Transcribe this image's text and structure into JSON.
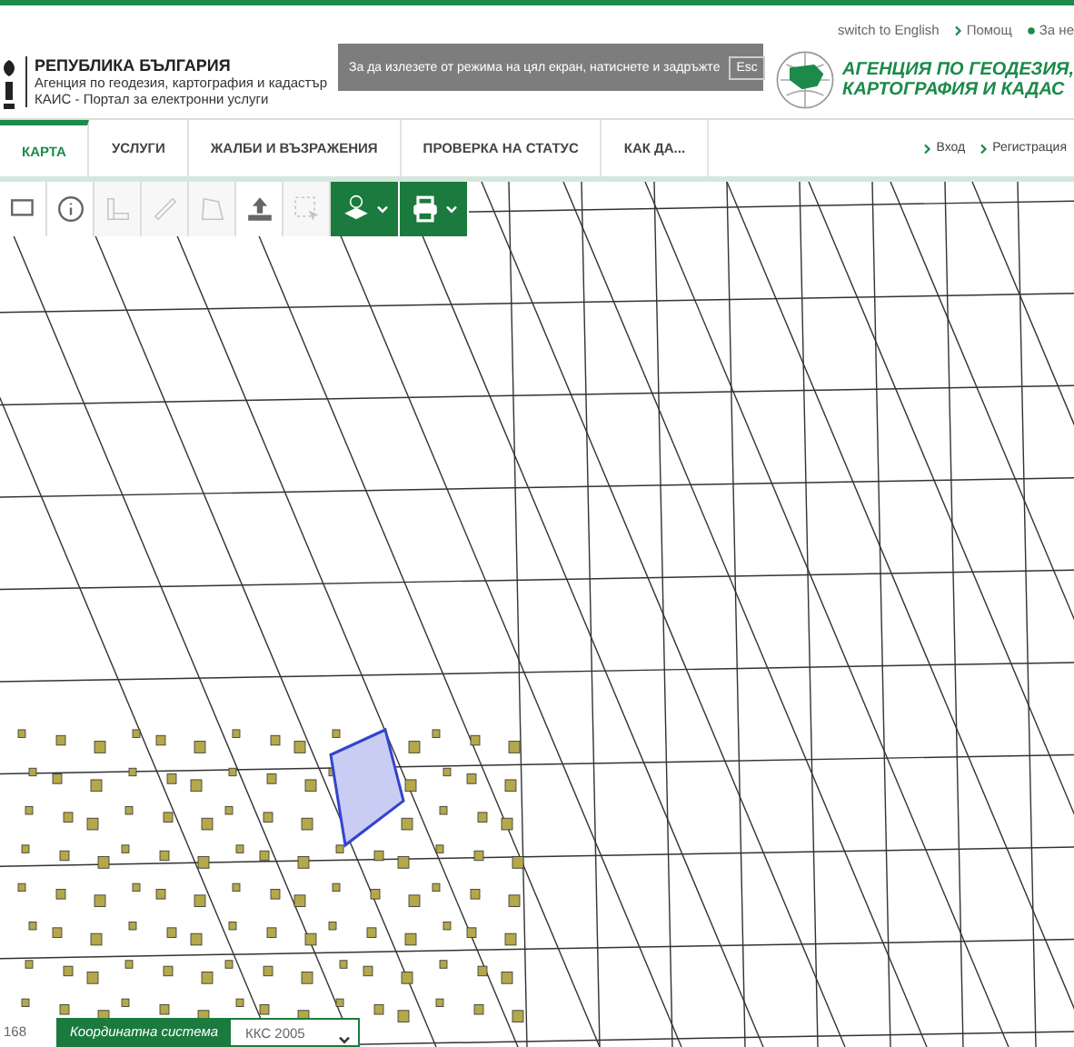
{
  "header": {
    "country": "РЕПУБЛИКА БЪЛГАРИЯ",
    "agency": "Агенция по геодезия, картография и кадастър",
    "portal": "КАИС - Портал за електронни услуги",
    "agency_logo_lines": [
      "АГЕНЦИЯ ПО ГЕОДЕЗИЯ,",
      "КАРТОГРАФИЯ И КАДАС"
    ]
  },
  "top_links": [
    {
      "label": "switch to English",
      "kind": "plain"
    },
    {
      "label": "Помощ",
      "kind": "chevron"
    },
    {
      "label": "За не",
      "kind": "eye"
    }
  ],
  "fullscreen_notice": {
    "text": "За да излезете от режима на цял екран, натиснете и задръжте",
    "key": "Esc"
  },
  "tabs": [
    {
      "label": "КАРТА",
      "selected": true
    },
    {
      "label": "УСЛУГИ",
      "selected": false
    },
    {
      "label": "ЖАЛБИ И ВЪЗРАЖЕНИЯ",
      "selected": false
    },
    {
      "label": "ПРОВЕРКА НА СТАТУС",
      "selected": false
    },
    {
      "label": "КАК ДА...",
      "selected": false
    }
  ],
  "account_links": [
    {
      "label": "Вход"
    },
    {
      "label": "Регистрация"
    }
  ],
  "toolbar": [
    {
      "kind": "screen",
      "disabled": false
    },
    {
      "kind": "info",
      "disabled": false
    },
    {
      "kind": "ruler-area",
      "disabled": true
    },
    {
      "kind": "ruler",
      "disabled": true
    },
    {
      "kind": "polygon",
      "disabled": true
    },
    {
      "kind": "upload",
      "disabled": false
    },
    {
      "kind": "select",
      "disabled": true
    },
    {
      "kind": "layers"
    },
    {
      "kind": "print"
    }
  ],
  "status_bar": {
    "scale": "168",
    "crs_label": "Координатна система",
    "crs_value": "ККС 2005"
  }
}
